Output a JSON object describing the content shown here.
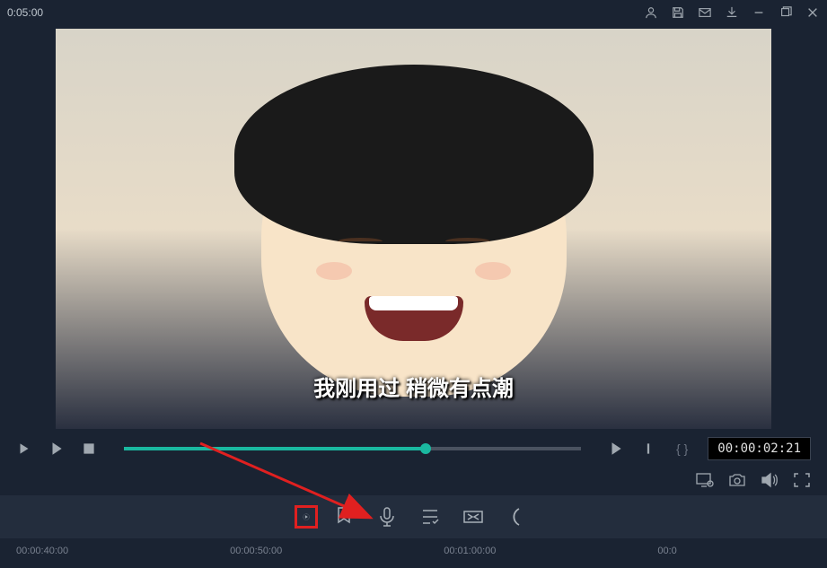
{
  "titlebar": {
    "time_indicator": "0:05:00"
  },
  "video": {
    "subtitle": "我刚用过 稍微有点潮"
  },
  "player": {
    "timecode": "00:00:02:21",
    "braces": "{  }"
  },
  "timeline": {
    "marks": [
      "00:00:40:00",
      "00:00:50:00",
      "00:01:00:00",
      "00:0"
    ]
  },
  "annotation": {
    "color": "#e02020"
  },
  "colors": {
    "accent": "#1ab8a0",
    "bg": "#1a2332",
    "toolbar": "#232d3d"
  }
}
